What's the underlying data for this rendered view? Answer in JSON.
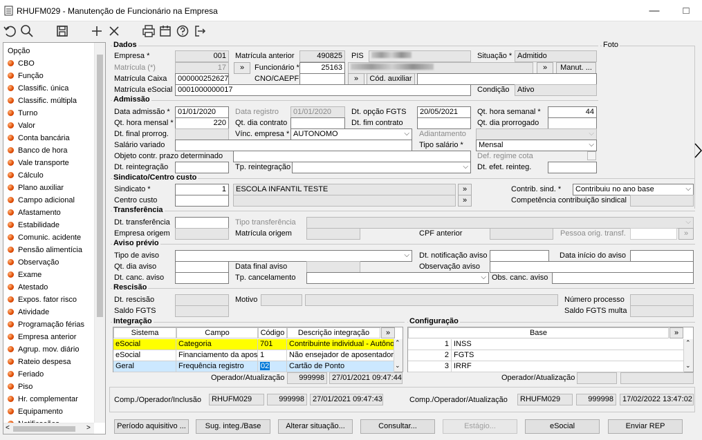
{
  "window": {
    "title": "RHUFM029 - Manutenção de Funcionário na Empresa",
    "min": "—",
    "max": "□",
    "close": "✕"
  },
  "toolbar": {
    "icons": [
      "undo-icon",
      "search-icon",
      "save-icon",
      "add-icon",
      "delete-icon",
      "print-icon",
      "calendar-icon",
      "help-icon",
      "exit-icon"
    ]
  },
  "left": {
    "header": "Opção",
    "items": [
      "CBO",
      "Função",
      "Classific. única",
      "Classific. múltipla",
      "Turno",
      "Valor",
      "Conta bancária",
      "Banco de hora",
      "Vale transporte",
      "Cálculo",
      "Plano auxiliar",
      "Campo adicional",
      "Afastamento",
      "Estabilidade",
      "Comunic. acidente",
      "Pensão alimentícia",
      "Observação",
      "Exame",
      "Atestado",
      "Expos. fator risco",
      "Atividade",
      "Programação férias",
      "Empresa anterior",
      "Agrup. mov. diário",
      "Rateio despesa",
      "Feriado",
      "Piso",
      "Hr. complementar",
      "Equipamento",
      "Notificações"
    ]
  },
  "foto": "Foto",
  "dados": {
    "title": "Dados",
    "empresa_l": "Empresa *",
    "empresa": "001",
    "matricula_ant_l": "Matrícula anterior",
    "matricula_ant": "490825",
    "pis_l": "PIS",
    "situacao_l": "Situação *",
    "situacao": "Admitido",
    "matricula_l": "Matrícula (*)",
    "matricula": "17",
    "funcionario_l": "Funcionário *",
    "funcionario": "25163",
    "manut": "Manut. ...",
    "matricula_caixa_l": "Matrícula Caixa",
    "matricula_caixa": "000000252627",
    "cno_l": "CNO/CAEPF",
    "cod_aux": "Cód. auxiliar",
    "matricula_esocial_l": "Matrícula eSocial",
    "matricula_esocial": "0001000000017",
    "condicao_l": "Condição",
    "condicao": "Ativo"
  },
  "admissao": {
    "title": "Admissão",
    "data_adm_l": "Data admissão *",
    "data_adm": "01/01/2020",
    "data_reg_l": "Data registro",
    "data_reg": "01/01/2020",
    "dt_fgts_l": "Dt. opção FGTS",
    "dt_fgts": "20/05/2021",
    "qt_sem_l": "Qt. hora semanal *",
    "qt_sem": "44",
    "qt_mensal_l": "Qt. hora mensal *",
    "qt_mensal": "220",
    "qt_dia_contrato_l": "Qt. dia contrato",
    "dt_fim_contrato_l": "Dt. fim contrato",
    "qt_dia_prorrogado_l": "Qt. dia prorrogado",
    "dt_final_l": "Dt. final prorrog.",
    "vinc_l": "Vínc. empresa *",
    "vinc": "AUTONOMO",
    "adiant_l": "Adiantamento",
    "sal_var_l": "Salário variado",
    "tipo_sal_l": "Tipo salário *",
    "tipo_sal": "Mensal",
    "obj_l": "Objeto contr. prazo determinado",
    "def_l": "Def. regime cota",
    "dt_reint_l": "Dt. reintegração",
    "tp_reint_l": "Tp. reintegração",
    "dt_efet_l": "Dt. efet. reinteg."
  },
  "sindicato": {
    "title": "Sindicato/Centro custo",
    "sind_l": "Sindicato *",
    "sind": "1",
    "sind_nome": "ESCOLA INFANTIL TESTE",
    "contrib_l": "Contrib. sind. *",
    "contrib": "Contribuiu no ano base",
    "cc_l": "Centro custo",
    "comp_l": "Competência contribuição sindical"
  },
  "transf": {
    "title": "Transferência",
    "dt_l": "Dt. transferência",
    "tipo_l": "Tipo transferência",
    "emp_l": "Empresa origem",
    "mat_l": "Matrícula origem",
    "cpf_l": "CPF anterior",
    "pessoa_l": "Pessoa orig. transf."
  },
  "aviso": {
    "title": "Aviso prévio",
    "tipo_l": "Tipo de aviso",
    "dt_not_l": "Dt. notificação aviso",
    "dt_ini_l": "Data início do aviso",
    "qt_l": "Qt. dia aviso",
    "dt_final_l": "Data final aviso",
    "obs_l": "Observação aviso",
    "dt_canc_l": "Dt. canc. aviso",
    "tp_canc_l": "Tp. cancelamento",
    "obs_canc_l": "Obs. canc. aviso"
  },
  "rescisao": {
    "title": "Rescisão",
    "dt_l": "Dt. rescisão",
    "motivo_l": "Motivo",
    "num_l": "Número processo",
    "saldo_l": "Saldo FGTS",
    "saldo_multa_l": "Saldo FGTS multa"
  },
  "integracao": {
    "title": "Integração",
    "headers": [
      "Sistema",
      "Campo",
      "Código",
      "Descrição integração"
    ],
    "rows": [
      {
        "sistema": "eSocial",
        "campo": "Categoria",
        "codigo": "701",
        "descricao": "Contribuinte individual - Autônor"
      },
      {
        "sistema": "eSocial",
        "campo": "Financiamento da aposen",
        "codigo": "1",
        "descricao": "Não ensejador de aposentador"
      },
      {
        "sistema": "Geral",
        "campo": "Frequência registro",
        "codigo": "02",
        "descricao": "Cartão de Ponto"
      }
    ],
    "op_l": "Operador/Atualização",
    "op": "999998",
    "op_dt": "27/01/2021 09:47:44"
  },
  "config": {
    "title": "Configuração",
    "header": "Base",
    "rows": [
      {
        "n": "1",
        "nome": "INSS"
      },
      {
        "n": "2",
        "nome": "FGTS"
      },
      {
        "n": "3",
        "nome": "IRRF"
      }
    ],
    "op_l": "Operador/Atualização"
  },
  "footer": {
    "inc_l": "Comp./Operador/Inclusão",
    "inc_comp": "RHUFM029",
    "inc_op": "999998",
    "inc_dt": "27/01/2021 09:47:43",
    "atu_l": "Comp./Operador/Atualização",
    "atu_comp": "RHUFM029",
    "atu_op": "999998",
    "atu_dt": "17/02/2022 13:47:02"
  },
  "buttons": [
    "Período aquisitivo ...",
    "Sug. integ./Base",
    "Alterar situação...",
    "Consultar...",
    "Estágio...",
    "eSocial",
    "Enviar REP"
  ],
  "colors": {
    "highlight_row": "#ffff00",
    "selected_row": "#cce8ff",
    "code_selected": "#0078d7"
  }
}
